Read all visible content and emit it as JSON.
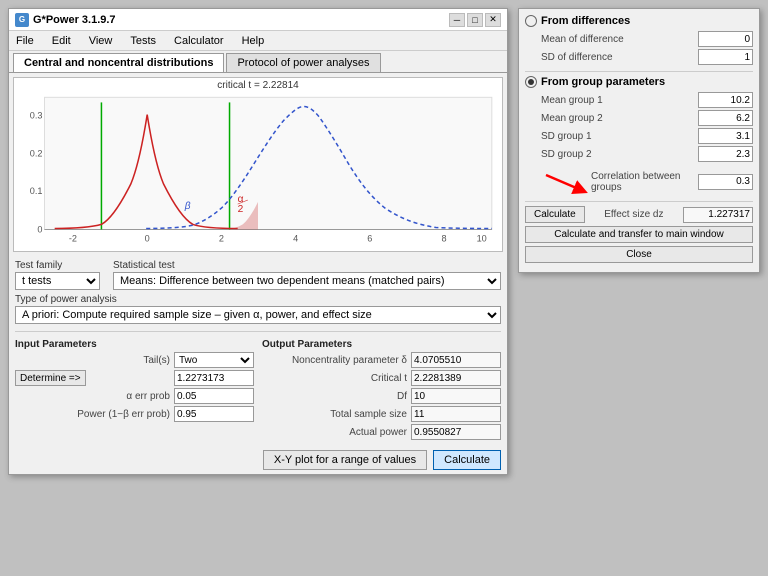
{
  "window": {
    "title": "G*Power 3.1.9.7",
    "icon": "G"
  },
  "menu": {
    "items": [
      "File",
      "Edit",
      "View",
      "Tests",
      "Calculator",
      "Help"
    ]
  },
  "tabs": {
    "items": [
      "Central and noncentral distributions",
      "Protocol of power analyses"
    ],
    "active": 0
  },
  "chart": {
    "critical_t_label": "critical t = 2.22814"
  },
  "test_family": {
    "label": "Test family",
    "value": "t tests"
  },
  "statistical_test": {
    "label": "Statistical test",
    "value": "Means: Difference between two dependent means (matched pairs)"
  },
  "power_analysis": {
    "label": "Type of power analysis",
    "value": "A priori: Compute required sample size – given α, power, and effect size"
  },
  "input_params": {
    "title": "Input Parameters",
    "tails_label": "Tail(s)",
    "tails_value": "Two",
    "effect_size_label": "Effect size dz",
    "effect_size_value": "1.2273173",
    "alpha_label": "α err prob",
    "alpha_value": "0.05",
    "power_label": "Power (1−β err prob)",
    "power_value": "0.95",
    "determine_label": "Determine =>"
  },
  "output_params": {
    "title": "Output Parameters",
    "noncentrality_label": "Noncentrality parameter δ",
    "noncentrality_value": "4.0705510",
    "critical_t_label": "Critical t",
    "critical_t_value": "2.2281389",
    "df_label": "Df",
    "df_value": "10",
    "total_sample_label": "Total sample size",
    "total_sample_value": "11",
    "actual_power_label": "Actual power",
    "actual_power_value": "0.9550827"
  },
  "bottom_buttons": {
    "xy_plot": "X-Y plot for a range of values",
    "calculate": "Calculate"
  },
  "right_panel": {
    "from_differences_label": "From differences",
    "mean_diff_label": "Mean of difference",
    "mean_diff_value": "0",
    "sd_diff_label": "SD of difference",
    "sd_diff_value": "1",
    "from_group_label": "From group parameters",
    "mean_group1_label": "Mean group 1",
    "mean_group1_value": "10.2",
    "mean_group2_label": "Mean group 2",
    "mean_group2_value": "6.2",
    "sd_group1_label": "SD group 1",
    "sd_group1_value": "3.1",
    "sd_group2_label": "SD group 2",
    "sd_group2_value": "2.3",
    "correlation_label": "Correlation between groups",
    "correlation_value": "0.3",
    "calculate_label": "Calculate",
    "effect_size_dz_label": "Effect size dz",
    "effect_size_dz_value": "1.227317",
    "transfer_label": "Calculate and transfer to main window",
    "close_label": "Close"
  }
}
